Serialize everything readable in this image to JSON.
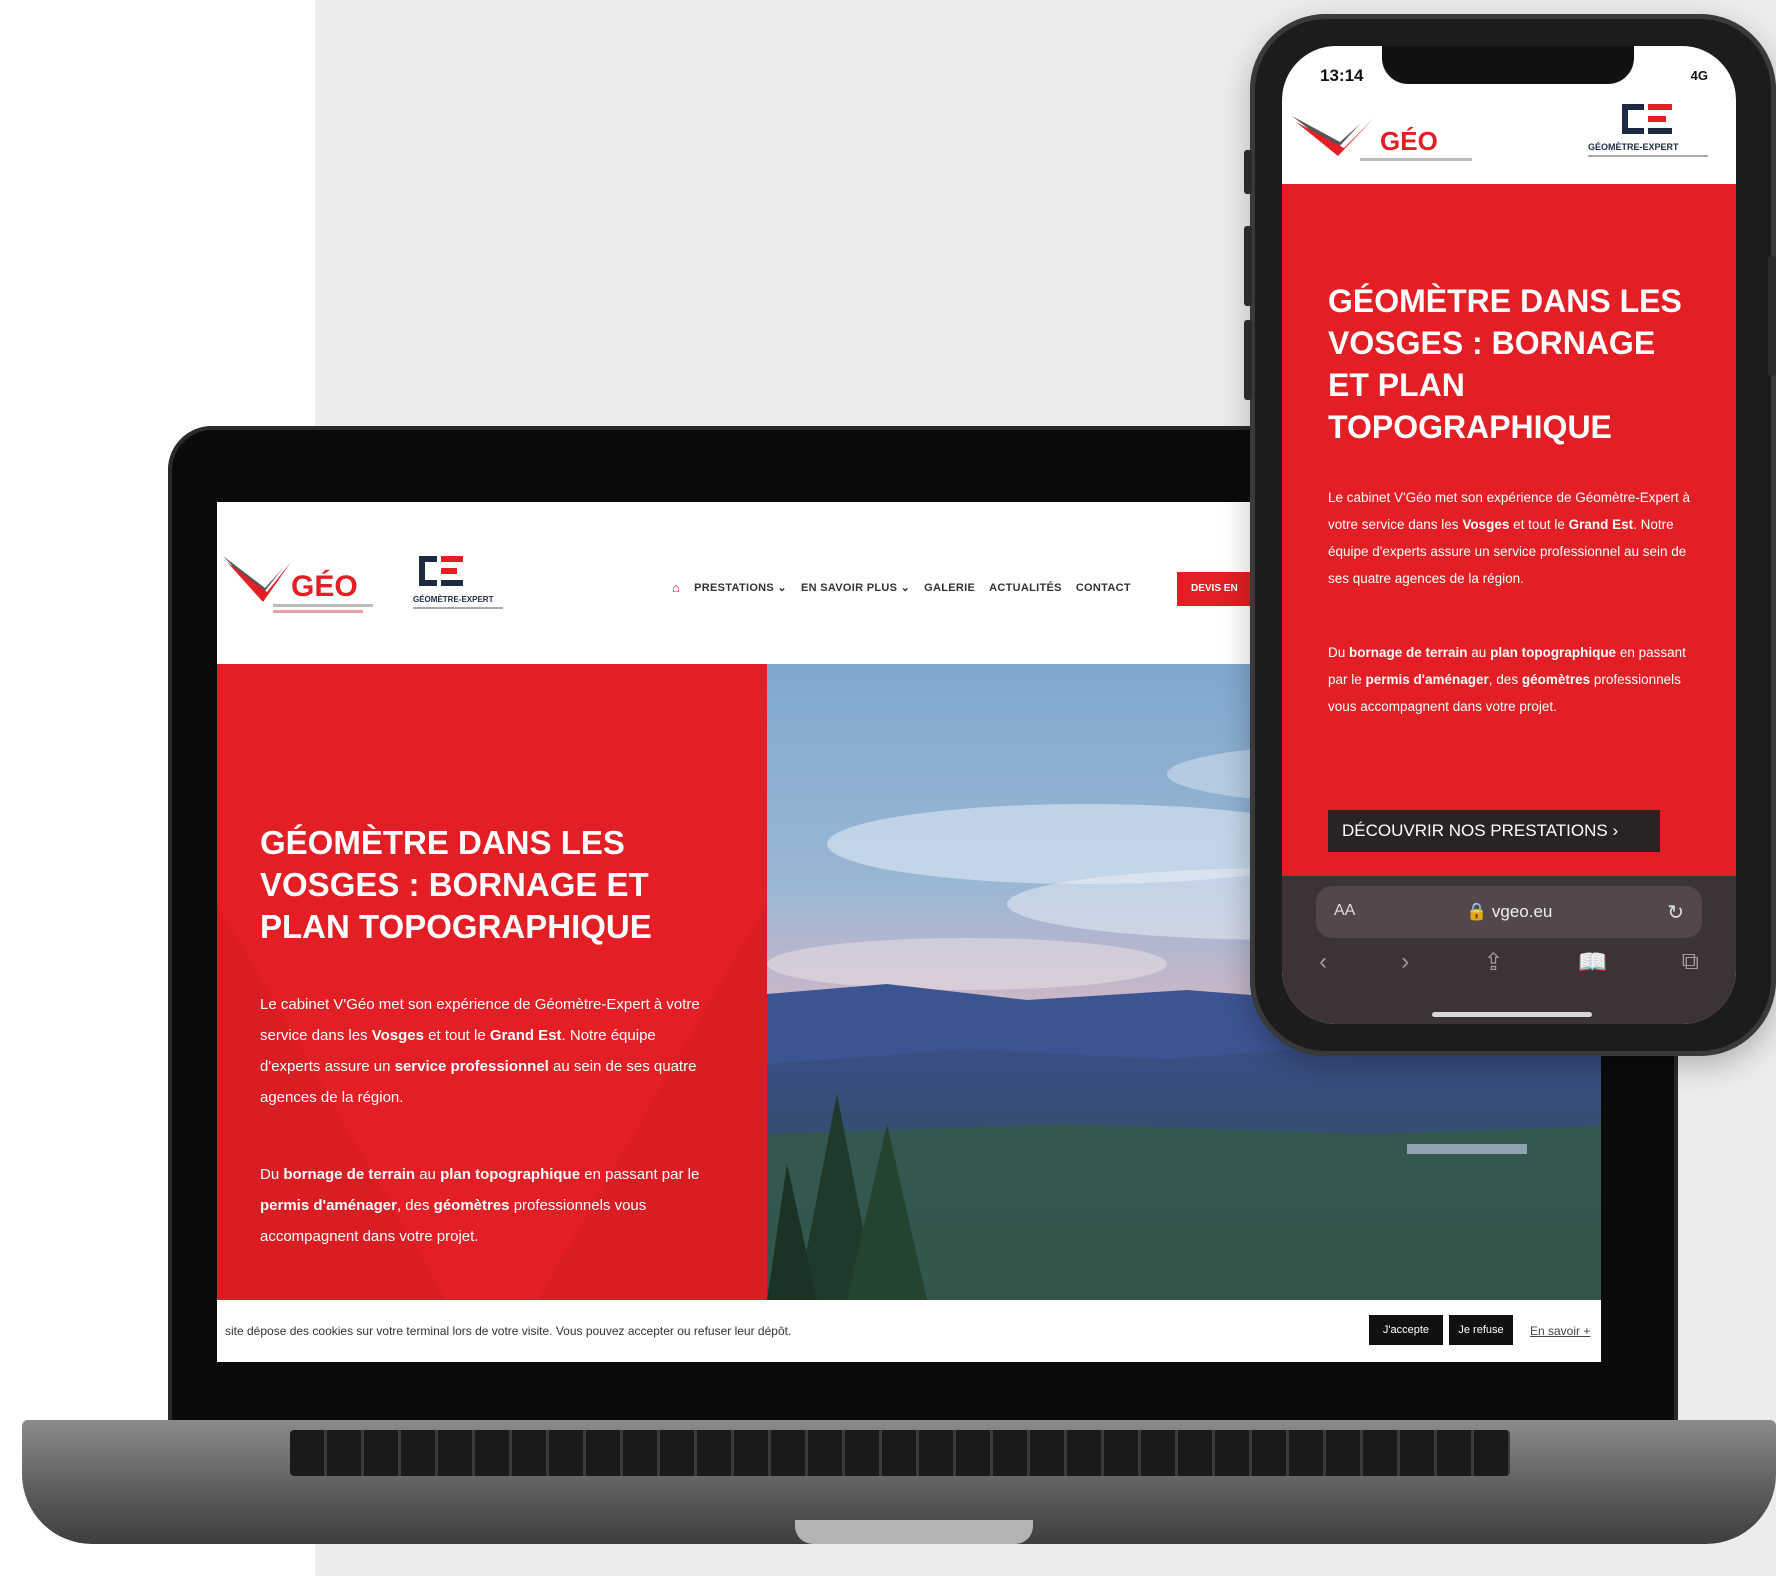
{
  "colors": {
    "brand_red": "#e31e24",
    "dark": "#111111",
    "page_bg": "#ececec"
  },
  "laptop": {
    "nav": {
      "home_icon": "home-icon",
      "items": [
        "PRESTATIONS",
        "EN SAVOIR PLUS",
        "GALERIE",
        "ACTUALITÉS",
        "CONTACT"
      ],
      "dropdown_marker": "⌄",
      "cta": "DEVIS EN"
    },
    "logos": {
      "vgeo_text": "GÉO",
      "ge_caption": "GÉOMÈTRE-EXPERT"
    },
    "hero": {
      "title": "GÉOMÈTRE DANS LES VOSGES : BORNAGE ET PLAN TOPOGRAPHIQUE",
      "p1": {
        "a": "Le cabinet V'Géo met son expérience de Géomètre-Expert à votre service dans les ",
        "b1": "Vosges",
        "c": " et tout le ",
        "b2": "Grand Est",
        "d": ". Notre équipe d'experts assure un ",
        "b3": "service professionnel",
        "e": " au sein de ses quatre agences de la région."
      },
      "p2": {
        "a": "Du ",
        "b1": "bornage de terrain",
        "c": " au ",
        "b2": "plan topographique",
        "d": " en passant par le ",
        "b3": "permis d'aménager",
        "e": ", des ",
        "b4": "géomètres",
        "f": " professionnels vous accompagnent dans votre projet."
      }
    },
    "cookie": {
      "text": "site dépose des cookies sur votre terminal lors de votre visite. Vous pouvez accepter ou refuser leur dépôt.",
      "accept": "J'accepte",
      "refuse": "Je refuse",
      "more": "En savoir +"
    }
  },
  "phone": {
    "status": {
      "time": "13:14",
      "right": "4G"
    },
    "logos": {
      "vgeo_text": "GÉO",
      "ge_caption": "GÉOMÈTRE-EXPERT"
    },
    "hero": {
      "title": "GÉOMÈTRE DANS LES VOSGES : BORNAGE ET PLAN TOPOGRAPHIQUE",
      "p1": {
        "a": "Le cabinet V'Géo met son expérience de Géomètre-Expert à votre service dans les ",
        "b1": "Vosges",
        "c": " et tout le ",
        "b2": "Grand Est",
        "d": ". Notre équipe d'experts assure un service professionnel au sein de ses quatre agences de la région."
      },
      "p2": {
        "a": "Du ",
        "b1": "bornage de terrain",
        "c": " au ",
        "b2": "plan topographique",
        "d": " en passant par le ",
        "b3": "permis d'aménager",
        "e": ", des ",
        "b4": "géomètres",
        "f": " professionnels vous accompagnent dans votre projet."
      },
      "cta": "DÉCOUVRIR NOS PRESTATIONS  ›"
    },
    "browser": {
      "aa": "AA",
      "url": "🔒 vgeo.eu",
      "reload_icon": "↻",
      "tools": [
        "‹",
        "›",
        "⇪",
        "📖",
        "⧉"
      ]
    }
  }
}
